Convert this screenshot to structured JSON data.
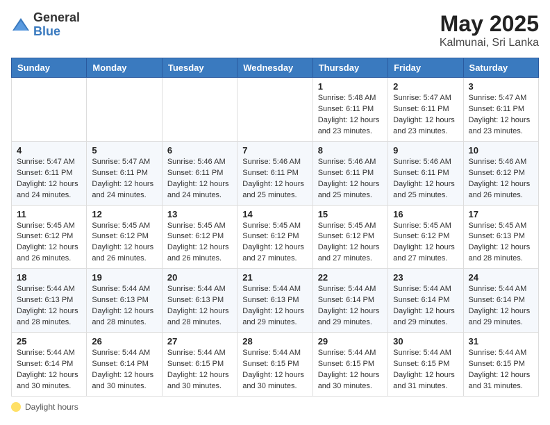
{
  "header": {
    "logo_general": "General",
    "logo_blue": "Blue",
    "title": "May 2025",
    "location": "Kalmunai, Sri Lanka"
  },
  "days_of_week": [
    "Sunday",
    "Monday",
    "Tuesday",
    "Wednesday",
    "Thursday",
    "Friday",
    "Saturday"
  ],
  "legend": {
    "label": "Daylight hours"
  },
  "weeks": [
    [
      {
        "day": "",
        "info": ""
      },
      {
        "day": "",
        "info": ""
      },
      {
        "day": "",
        "info": ""
      },
      {
        "day": "",
        "info": ""
      },
      {
        "day": "1",
        "info": "Sunrise: 5:48 AM\nSunset: 6:11 PM\nDaylight: 12 hours\nand 23 minutes."
      },
      {
        "day": "2",
        "info": "Sunrise: 5:47 AM\nSunset: 6:11 PM\nDaylight: 12 hours\nand 23 minutes."
      },
      {
        "day": "3",
        "info": "Sunrise: 5:47 AM\nSunset: 6:11 PM\nDaylight: 12 hours\nand 23 minutes."
      }
    ],
    [
      {
        "day": "4",
        "info": "Sunrise: 5:47 AM\nSunset: 6:11 PM\nDaylight: 12 hours\nand 24 minutes."
      },
      {
        "day": "5",
        "info": "Sunrise: 5:47 AM\nSunset: 6:11 PM\nDaylight: 12 hours\nand 24 minutes."
      },
      {
        "day": "6",
        "info": "Sunrise: 5:46 AM\nSunset: 6:11 PM\nDaylight: 12 hours\nand 24 minutes."
      },
      {
        "day": "7",
        "info": "Sunrise: 5:46 AM\nSunset: 6:11 PM\nDaylight: 12 hours\nand 25 minutes."
      },
      {
        "day": "8",
        "info": "Sunrise: 5:46 AM\nSunset: 6:11 PM\nDaylight: 12 hours\nand 25 minutes."
      },
      {
        "day": "9",
        "info": "Sunrise: 5:46 AM\nSunset: 6:11 PM\nDaylight: 12 hours\nand 25 minutes."
      },
      {
        "day": "10",
        "info": "Sunrise: 5:46 AM\nSunset: 6:12 PM\nDaylight: 12 hours\nand 26 minutes."
      }
    ],
    [
      {
        "day": "11",
        "info": "Sunrise: 5:45 AM\nSunset: 6:12 PM\nDaylight: 12 hours\nand 26 minutes."
      },
      {
        "day": "12",
        "info": "Sunrise: 5:45 AM\nSunset: 6:12 PM\nDaylight: 12 hours\nand 26 minutes."
      },
      {
        "day": "13",
        "info": "Sunrise: 5:45 AM\nSunset: 6:12 PM\nDaylight: 12 hours\nand 26 minutes."
      },
      {
        "day": "14",
        "info": "Sunrise: 5:45 AM\nSunset: 6:12 PM\nDaylight: 12 hours\nand 27 minutes."
      },
      {
        "day": "15",
        "info": "Sunrise: 5:45 AM\nSunset: 6:12 PM\nDaylight: 12 hours\nand 27 minutes."
      },
      {
        "day": "16",
        "info": "Sunrise: 5:45 AM\nSunset: 6:12 PM\nDaylight: 12 hours\nand 27 minutes."
      },
      {
        "day": "17",
        "info": "Sunrise: 5:45 AM\nSunset: 6:13 PM\nDaylight: 12 hours\nand 28 minutes."
      }
    ],
    [
      {
        "day": "18",
        "info": "Sunrise: 5:44 AM\nSunset: 6:13 PM\nDaylight: 12 hours\nand 28 minutes."
      },
      {
        "day": "19",
        "info": "Sunrise: 5:44 AM\nSunset: 6:13 PM\nDaylight: 12 hours\nand 28 minutes."
      },
      {
        "day": "20",
        "info": "Sunrise: 5:44 AM\nSunset: 6:13 PM\nDaylight: 12 hours\nand 28 minutes."
      },
      {
        "day": "21",
        "info": "Sunrise: 5:44 AM\nSunset: 6:13 PM\nDaylight: 12 hours\nand 29 minutes."
      },
      {
        "day": "22",
        "info": "Sunrise: 5:44 AM\nSunset: 6:14 PM\nDaylight: 12 hours\nand 29 minutes."
      },
      {
        "day": "23",
        "info": "Sunrise: 5:44 AM\nSunset: 6:14 PM\nDaylight: 12 hours\nand 29 minutes."
      },
      {
        "day": "24",
        "info": "Sunrise: 5:44 AM\nSunset: 6:14 PM\nDaylight: 12 hours\nand 29 minutes."
      }
    ],
    [
      {
        "day": "25",
        "info": "Sunrise: 5:44 AM\nSunset: 6:14 PM\nDaylight: 12 hours\nand 30 minutes."
      },
      {
        "day": "26",
        "info": "Sunrise: 5:44 AM\nSunset: 6:14 PM\nDaylight: 12 hours\nand 30 minutes."
      },
      {
        "day": "27",
        "info": "Sunrise: 5:44 AM\nSunset: 6:15 PM\nDaylight: 12 hours\nand 30 minutes."
      },
      {
        "day": "28",
        "info": "Sunrise: 5:44 AM\nSunset: 6:15 PM\nDaylight: 12 hours\nand 30 minutes."
      },
      {
        "day": "29",
        "info": "Sunrise: 5:44 AM\nSunset: 6:15 PM\nDaylight: 12 hours\nand 30 minutes."
      },
      {
        "day": "30",
        "info": "Sunrise: 5:44 AM\nSunset: 6:15 PM\nDaylight: 12 hours\nand 31 minutes."
      },
      {
        "day": "31",
        "info": "Sunrise: 5:44 AM\nSunset: 6:15 PM\nDaylight: 12 hours\nand 31 minutes."
      }
    ]
  ]
}
